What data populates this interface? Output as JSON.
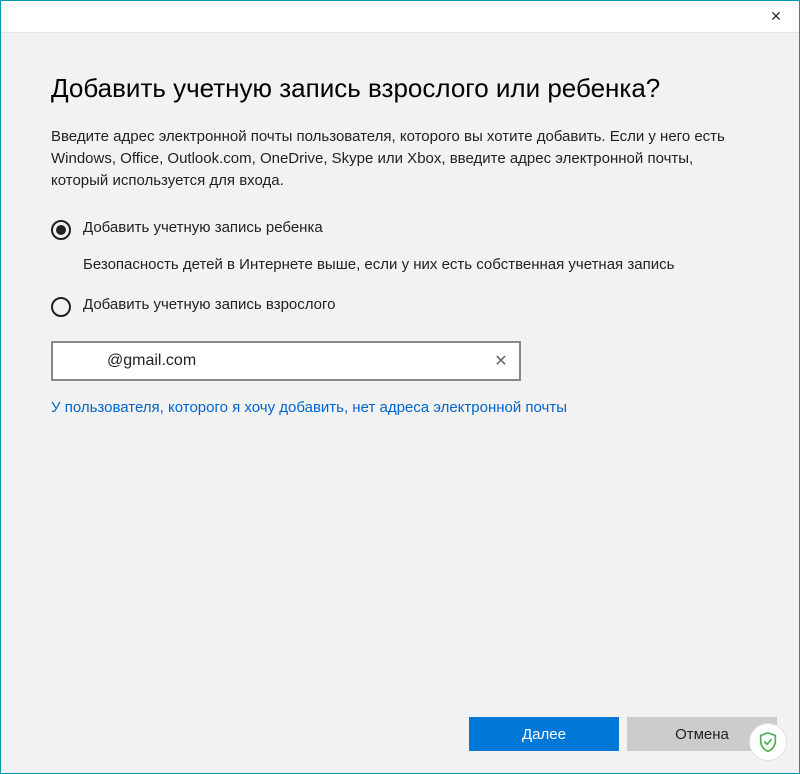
{
  "heading": "Добавить учетную запись взрослого или ребенка?",
  "description": "Введите адрес электронной почты пользователя, которого вы хотите добавить. Если у него есть Windows, Office, Outlook.com, OneDrive, Skype или Xbox, введите адрес электронной почты, который используется для входа.",
  "options": {
    "child_label": "Добавить учетную запись ребенка",
    "child_subtext": "Безопасность детей в Интернете выше, если у них есть собственная учетная запись",
    "adult_label": "Добавить учетную запись взрослого"
  },
  "email": {
    "value": "         @gmail.com"
  },
  "no_email_link": "У пользователя, которого я хочу добавить, нет адреса электронной почты",
  "buttons": {
    "next": "Далее",
    "cancel": "Отмена"
  },
  "close_glyph": "✕"
}
